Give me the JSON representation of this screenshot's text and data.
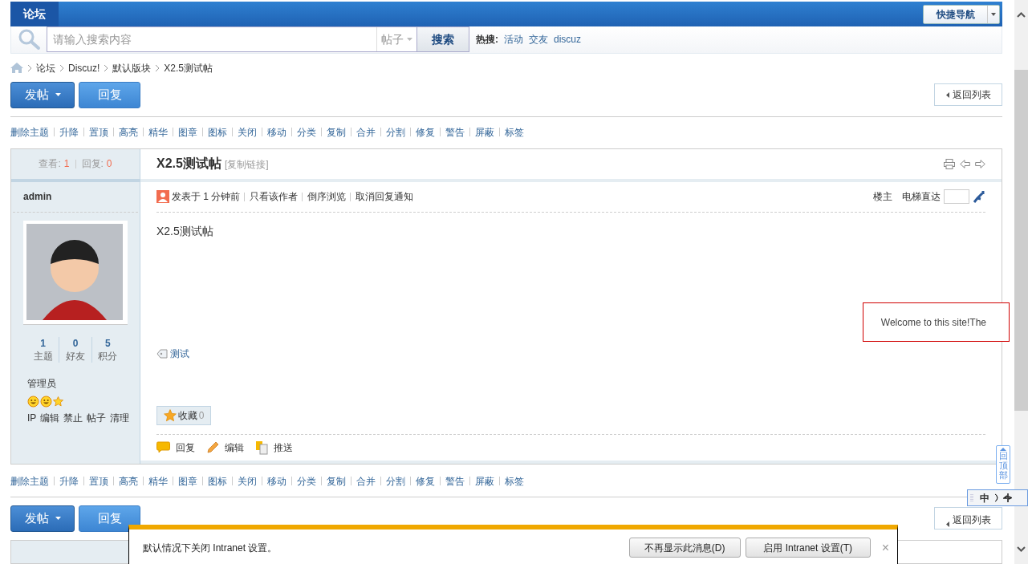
{
  "top_nav": {
    "tab": "论坛",
    "quick_nav": "快捷导航"
  },
  "search": {
    "placeholder": "请输入搜索内容",
    "scope": "帖子",
    "button": "搜索",
    "hot_label": "热搜:",
    "hot_terms": [
      "活动",
      "交友",
      "discuz"
    ]
  },
  "breadcrumb": [
    "论坛",
    "Discuz!",
    "默认版块",
    "X2.5测试帖"
  ],
  "actions_top": {
    "post": "发帖",
    "reply": "回复",
    "back": "返回列表"
  },
  "mod_tools_top": [
    "删除主题",
    "升降",
    "置顶",
    "高亮",
    "精华",
    "图章",
    "图标",
    "关闭",
    "移动",
    "分类",
    "复制",
    "合并",
    "分割",
    "修复",
    "警告",
    "屏蔽",
    "标签"
  ],
  "thread": {
    "views_label": "查看:",
    "views": "1",
    "replies_label": "回复:",
    "replies": "0",
    "title": "X2.5测试帖",
    "copy_link": "[复制链接]"
  },
  "post": {
    "author": "admin",
    "stats": [
      {
        "value": "1",
        "label": "主题"
      },
      {
        "value": "0",
        "label": "好友"
      },
      {
        "value": "5",
        "label": "积分"
      }
    ],
    "group": "管理员",
    "admin_links": [
      "IP",
      "编辑",
      "禁止",
      "帖子",
      "清理"
    ],
    "posted": "发表于 1 分钟前",
    "links": [
      "只看该作者",
      "倒序浏览",
      "取消回复通知"
    ],
    "floor": "楼主",
    "jump_label": "电梯直达",
    "body": "X2.5测试帖",
    "tag": "测试",
    "favorite": "收藏",
    "favorite_count": "0",
    "footer_actions": [
      {
        "kind": "reply",
        "label": "回复"
      },
      {
        "kind": "edit",
        "label": "编辑"
      },
      {
        "kind": "push",
        "label": "推送"
      }
    ]
  },
  "mod_tools_bottom": [
    "删除主题",
    "升降",
    "置顶",
    "高亮",
    "精华",
    "图章",
    "图标",
    "关闭",
    "移动",
    "分类",
    "复制",
    "合并",
    "分割",
    "修复",
    "警告",
    "屏蔽",
    "标签"
  ],
  "actions_bottom": {
    "post": "发帖",
    "reply": "回复",
    "back": "返回列表"
  },
  "floating_notice": "Welcome to this site!The",
  "back_to_top": "回顶部",
  "ime_bar": {
    "mode": "中"
  },
  "notification_bar": {
    "message": "默认情况下关闭 Intranet 设置。",
    "buttons": [
      "不再显示此消息(D)",
      "启用 Intranet 设置(T)"
    ],
    "close": "×"
  }
}
